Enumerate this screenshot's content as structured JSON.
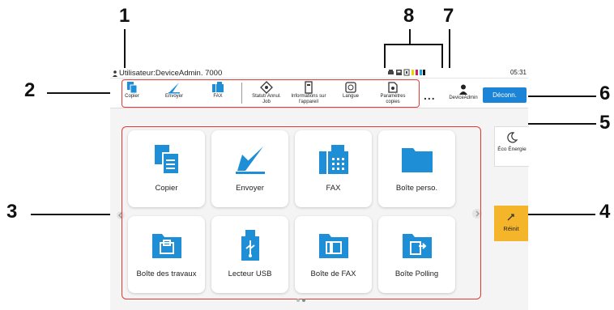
{
  "callouts": [
    "1",
    "2",
    "3",
    "4",
    "5",
    "6",
    "7",
    "8"
  ],
  "status_bar": {
    "user_label": "Utilisateur:DeviceAdmin. 7000",
    "time": "05:31"
  },
  "shortcuts": [
    {
      "label": "Copier",
      "icon": "copy-icon"
    },
    {
      "label": "Envoyer",
      "icon": "send-icon"
    },
    {
      "label": "FAX",
      "icon": "fax-icon"
    },
    {
      "label": "Statut/ Annul. Job",
      "icon": "status-icon"
    },
    {
      "label": "Informations sur l'appareil",
      "icon": "device-info-icon"
    },
    {
      "label": "Langue",
      "icon": "language-icon"
    },
    {
      "label": "Paramètres copies",
      "icon": "settings-icon"
    }
  ],
  "more_label": "...",
  "user_button_label": "DeviceAdmin",
  "logout_label": "Déconn.",
  "tiles": [
    {
      "label": "Copier",
      "icon": "copy-icon"
    },
    {
      "label": "Envoyer",
      "icon": "send-icon"
    },
    {
      "label": "FAX",
      "icon": "fax-icon"
    },
    {
      "label": "Boîte perso.",
      "icon": "folder-icon"
    },
    {
      "label": "Boîte des travaux",
      "icon": "job-box-icon"
    },
    {
      "label": "Lecteur USB",
      "icon": "usb-icon"
    },
    {
      "label": "Boîte de FAX",
      "icon": "fax-box-icon"
    },
    {
      "label": "Boîte Polling",
      "icon": "polling-box-icon"
    }
  ],
  "eco_label": "Éco Énergie",
  "reset_label": "Réinit",
  "colors": {
    "accent": "#1b84d6",
    "icon_blue": "#1e8fd6",
    "callout_box": "#e53935",
    "reset": "#f5b52a"
  }
}
